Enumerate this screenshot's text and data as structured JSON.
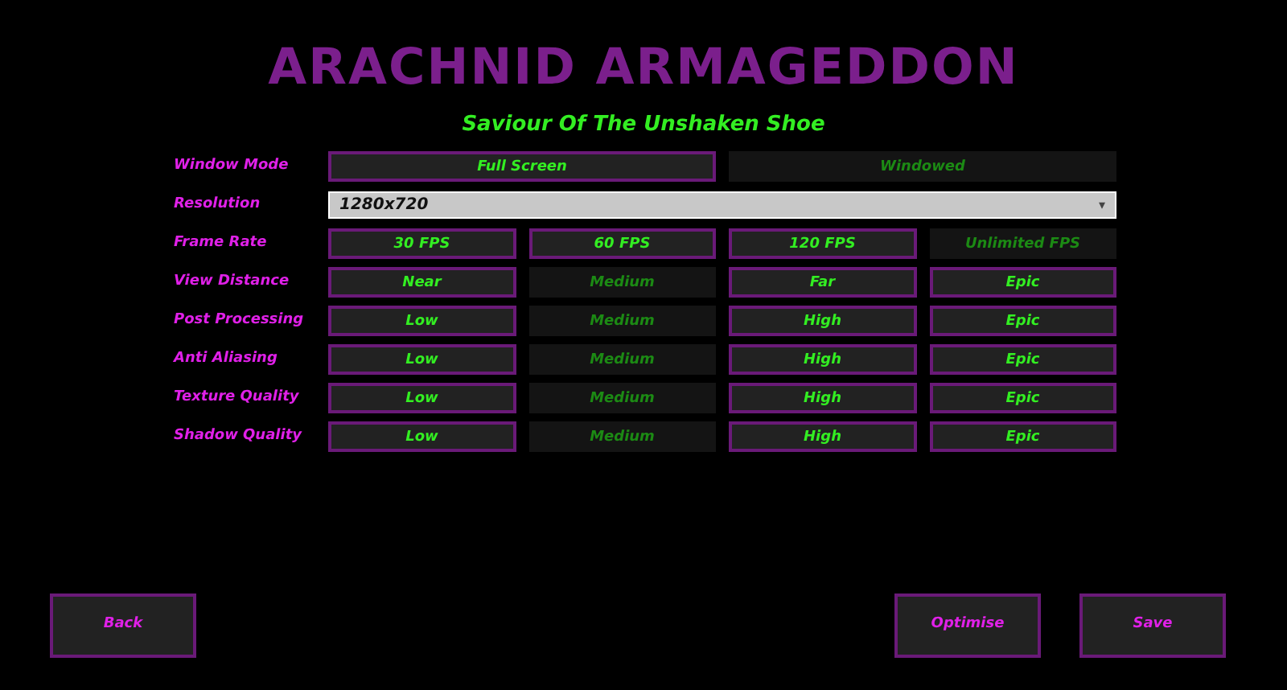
{
  "title": "ARACHNID ARMAGEDDON",
  "subtitle": "Saviour Of The Unshaken Shoe",
  "settings": [
    {
      "label": "Window Mode",
      "kind": "options",
      "options": [
        {
          "label": "Full Screen",
          "selected": false
        },
        {
          "label": "Windowed",
          "selected": true
        }
      ]
    },
    {
      "label": "Resolution",
      "kind": "dropdown",
      "value": "1280x720",
      "caret": "▾"
    },
    {
      "label": "Frame Rate",
      "kind": "options",
      "options": [
        {
          "label": "30 FPS",
          "selected": false
        },
        {
          "label": "60 FPS",
          "selected": false
        },
        {
          "label": "120 FPS",
          "selected": false
        },
        {
          "label": "Unlimited FPS",
          "selected": true
        }
      ]
    },
    {
      "label": "View Distance",
      "kind": "options",
      "options": [
        {
          "label": "Near",
          "selected": false
        },
        {
          "label": "Medium",
          "selected": true
        },
        {
          "label": "Far",
          "selected": false
        },
        {
          "label": "Epic",
          "selected": false
        }
      ]
    },
    {
      "label": "Post Processing",
      "kind": "options",
      "options": [
        {
          "label": "Low",
          "selected": false
        },
        {
          "label": "Medium",
          "selected": true
        },
        {
          "label": "High",
          "selected": false
        },
        {
          "label": "Epic",
          "selected": false
        }
      ]
    },
    {
      "label": "Anti Aliasing",
      "kind": "options",
      "options": [
        {
          "label": "Low",
          "selected": false
        },
        {
          "label": "Medium",
          "selected": true
        },
        {
          "label": "High",
          "selected": false
        },
        {
          "label": "Epic",
          "selected": false
        }
      ]
    },
    {
      "label": "Texture Quality",
      "kind": "options",
      "options": [
        {
          "label": "Low",
          "selected": false
        },
        {
          "label": "Medium",
          "selected": true
        },
        {
          "label": "High",
          "selected": false
        },
        {
          "label": "Epic",
          "selected": false
        }
      ]
    },
    {
      "label": "Shadow Quality",
      "kind": "options",
      "options": [
        {
          "label": "Low",
          "selected": false
        },
        {
          "label": "Medium",
          "selected": true
        },
        {
          "label": "High",
          "selected": false
        },
        {
          "label": "Epic",
          "selected": false
        }
      ]
    }
  ],
  "left_buttons": [
    "Back"
  ],
  "right_buttons": [
    "Optimise",
    "Save"
  ]
}
